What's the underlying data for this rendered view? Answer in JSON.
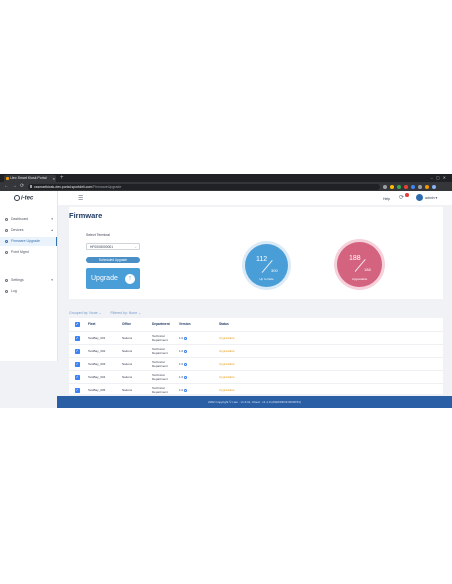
{
  "browser": {
    "tab_title": "i-tec Smart Kiosk Portal",
    "new_tab": "+",
    "window_controls": "–▢✕",
    "nav": "←→⟳",
    "url_host": "cssmartkiosk-dev.portal.sportdeli.com",
    "url_path": "/FirmwareUpgrade"
  },
  "app": {
    "brand": "i-tec",
    "help": "Help",
    "user": "admin"
  },
  "sidebar": {
    "items": [
      {
        "label": "Dashboard",
        "chevron": "▾"
      },
      {
        "label": "Devices",
        "chevron": "▴"
      },
      {
        "label": "Firmware Upgrade",
        "chevron": ""
      },
      {
        "label": "Point Mgmt",
        "chevron": ""
      },
      {
        "label": "Settings",
        "chevron": "▾"
      },
      {
        "label": "Log",
        "chevron": ""
      }
    ]
  },
  "page": {
    "title": "Firmware",
    "select_label": "Select Terminal",
    "select_value": "HF00X8000001",
    "schedule_button": "Scheduled Upgrade",
    "upgrade_button": "Upgrade",
    "upgrade_icon": "↑"
  },
  "stats": {
    "uptodate": {
      "count": "112",
      "total": "300",
      "label": "Up to Date"
    },
    "upgradable": {
      "count": "188",
      "total": "188",
      "label": "Upgradable"
    }
  },
  "filters": {
    "group": "Grouped by: None ⌄",
    "filter": "Filtered by: None ⌄"
  },
  "table": {
    "headers": [
      "",
      "Fleet",
      "Office",
      "Department",
      "Version",
      "Status"
    ],
    "rows": [
      {
        "fleet": "TestBay_001",
        "office": "Nations",
        "dept": "Technical Department",
        "version": "1.0",
        "status": "Upgradable"
      },
      {
        "fleet": "TestBay_002",
        "office": "Nations",
        "dept": "Technical Department",
        "version": "1.0",
        "status": "Upgradable"
      },
      {
        "fleet": "TestBay_003",
        "office": "Nations",
        "dept": "Technical Department",
        "version": "1.0",
        "status": "Upgradable"
      },
      {
        "fleet": "TestBay_004",
        "office": "Nations",
        "dept": "Technical Department",
        "version": "1.0",
        "status": "Upgradable"
      },
      {
        "fleet": "TestBay_005",
        "office": "Nations",
        "dept": "Technical Department",
        "version": "1.0",
        "status": "Upgradable"
      }
    ]
  },
  "footer": "2022 Copyright © i-tec · v1.3.11, Cloud · v1.1.0 (2022/03/19 09:08:51)",
  "colors": {
    "primary": "#4a9ed8",
    "upgradable": "#d4637f",
    "footer": "#2b5fa5",
    "status_warning": "#e8a020"
  }
}
